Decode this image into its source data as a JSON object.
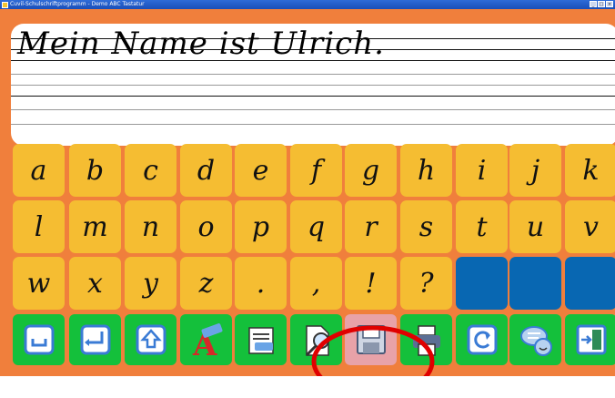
{
  "window": {
    "title": "Cuvil-Schulschriftprogramm - Demo ABC Tastatur",
    "buttons": [
      "_",
      "□",
      "×"
    ]
  },
  "document": {
    "text": "Mein Name ist Ulrich."
  },
  "keyboard": {
    "rows": [
      [
        "a",
        "b",
        "c",
        "d",
        "e",
        "f",
        "g",
        "h",
        "i",
        "j",
        "k"
      ],
      [
        "l",
        "m",
        "n",
        "o",
        "p",
        "q",
        "r",
        "s",
        "t",
        "u",
        "v"
      ],
      [
        "w",
        "x",
        "y",
        "z",
        ".",
        ",",
        "!",
        "?",
        "",
        "",
        ""
      ]
    ]
  },
  "toolbar": {
    "tools": [
      {
        "name": "space-icon"
      },
      {
        "name": "enter-icon"
      },
      {
        "name": "shift-icon"
      },
      {
        "name": "font-eraser-icon"
      },
      {
        "name": "clear-text-icon"
      },
      {
        "name": "zoom-icon"
      },
      {
        "name": "save-icon"
      },
      {
        "name": "print-icon"
      },
      {
        "name": "undo-icon"
      },
      {
        "name": "speech-icon"
      },
      {
        "name": "exit-icon"
      }
    ]
  },
  "colors": {
    "background": "#f07f3c",
    "key": "#f5bd32",
    "key_blank": "#0867b2",
    "tool": "#14c03b",
    "tool_selected": "#e8a2a8",
    "annotation": "#e00000"
  }
}
